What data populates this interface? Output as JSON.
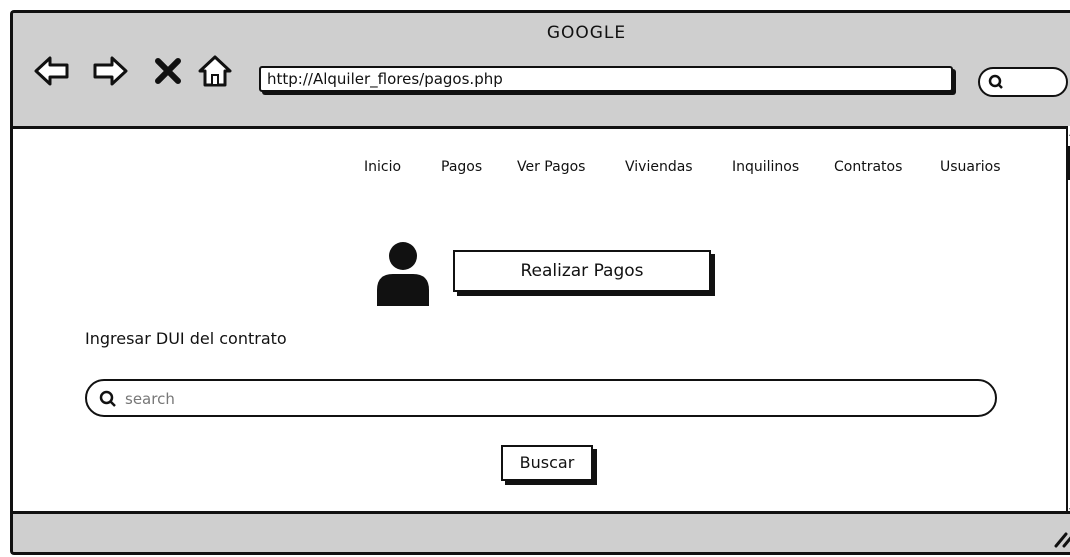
{
  "browser": {
    "title": "GOOGLE",
    "url": "http://Alquiler_flores/pagos.php",
    "icons": [
      "back-arrow-icon",
      "forward-arrow-icon",
      "close-icon",
      "home-icon",
      "search-icon"
    ]
  },
  "nav": {
    "items": [
      "Inicio",
      "Pagos",
      "Ver Pagos",
      "Viviendas",
      "Inquilinos",
      "Contratos",
      "Usuarios"
    ]
  },
  "main": {
    "action_button": "Realizar Pagos",
    "dui_label": "Ingresar DUI del contrato",
    "search_placeholder": "search",
    "search_button": "Buscar"
  }
}
